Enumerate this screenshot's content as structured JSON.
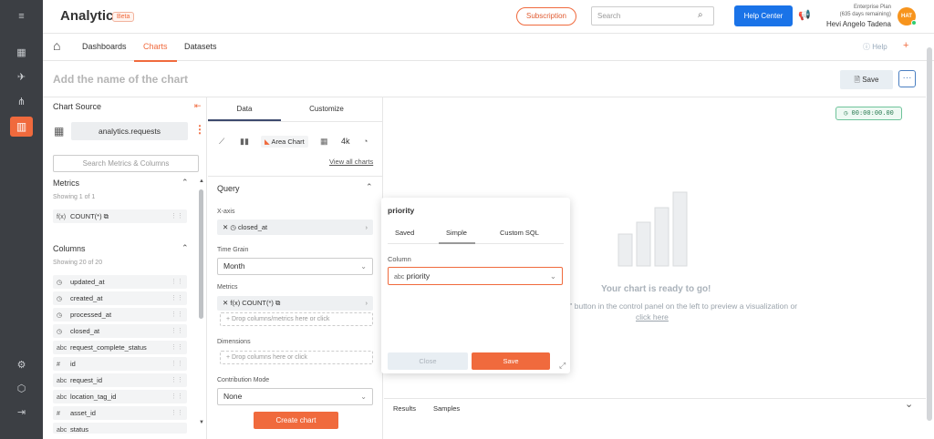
{
  "app": {
    "title": "Analytics",
    "badge": "Beta"
  },
  "topbar": {
    "subscription_label": "Subscription",
    "search_placeholder": "Search",
    "help_center_label": "Help Center",
    "plan_line1": "Enterprise Plan",
    "plan_line2": "(635 days remaining)",
    "user_name": "Hevi Angelo Tadena",
    "avatar_initials": "HAT"
  },
  "nav": {
    "items": [
      "Dashboards",
      "Charts",
      "Datasets"
    ],
    "active": "Charts",
    "help_label": "Help",
    "plus_label": "+"
  },
  "chart_header": {
    "title_placeholder": "Add the name of the chart",
    "save_label": "Save",
    "more_label": "···"
  },
  "left_panel": {
    "chart_source_label": "Chart Source",
    "dataset": "analytics.requests",
    "search_placeholder": "Search Metrics & Columns",
    "metrics_label": "Metrics",
    "metrics_showing": "Showing 1 of 1",
    "metrics": [
      {
        "icon": "f(x)",
        "name": "COUNT(*)"
      }
    ],
    "columns_label": "Columns",
    "columns_showing": "Showing 20 of 20",
    "columns": [
      {
        "type": "time",
        "name": "updated_at"
      },
      {
        "type": "time",
        "name": "created_at"
      },
      {
        "type": "time",
        "name": "processed_at"
      },
      {
        "type": "time",
        "name": "closed_at"
      },
      {
        "type": "abc",
        "name": "request_complete_status"
      },
      {
        "type": "#",
        "name": "id"
      },
      {
        "type": "abc",
        "name": "request_id"
      },
      {
        "type": "abc",
        "name": "location_tag_id"
      },
      {
        "type": "#",
        "name": "asset_id"
      },
      {
        "type": "abc",
        "name": "status"
      }
    ]
  },
  "middle_panel": {
    "tab_data": "Data",
    "tab_customize": "Customize",
    "area_chart_label": "Area Chart",
    "big_number_label": "4k",
    "view_all_label": "View all charts",
    "query_label": "Query",
    "xaxis_label": "X-axis",
    "xaxis_value": "closed_at",
    "time_grain_label": "Time Grain",
    "time_grain_value": "Month",
    "metrics_label": "Metrics",
    "metrics_value": "COUNT(*)",
    "metrics_drop": "Drop columns/metrics here or click",
    "dimensions_label": "Dimensions",
    "dimensions_drop": "Drop columns here or click",
    "contribution_label": "Contribution Mode",
    "contribution_value": "None",
    "create_label": "Create chart"
  },
  "right_panel": {
    "timer": "00:00:00.00",
    "ready_title": "Your chart is ready to go!",
    "ready_hint": "t\" button in the control panel on the left to preview a visualization or",
    "ready_link": "click here",
    "results_tab": "Results",
    "samples_tab": "Samples"
  },
  "popover": {
    "title": "priority",
    "tabs": [
      "Saved",
      "Simple",
      "Custom SQL"
    ],
    "active_tab": "Simple",
    "column_label": "Column",
    "column_type": "abc",
    "column_value": "priority",
    "close_label": "Close",
    "save_label": "Save"
  },
  "colors": {
    "accent": "#f06a3d",
    "sidebar": "#3c3f44",
    "primary_blue": "#1a73e8"
  }
}
